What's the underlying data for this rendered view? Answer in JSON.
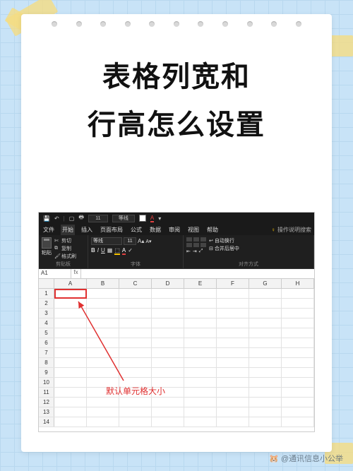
{
  "title_line1": "表格列宽和",
  "title_line2": "行高怎么设置",
  "qat": {
    "size_value": "11",
    "font_value": "等线"
  },
  "ribbon": {
    "tabs": [
      "文件",
      "开始",
      "插入",
      "页面布局",
      "公式",
      "数据",
      "审阅",
      "视图",
      "帮助"
    ],
    "tell_me": "操作说明搜索",
    "clipboard": {
      "paste": "粘贴",
      "cut": "剪切",
      "copy": "复制",
      "format_painter": "格式刷",
      "label": "剪贴板"
    },
    "font": {
      "name": "等线",
      "size": "11",
      "label": "字体"
    },
    "align": {
      "wrap": "自动换行",
      "merge": "合并后居中",
      "label": "对齐方式"
    }
  },
  "namebox": "A1",
  "columns": [
    "A",
    "B",
    "C",
    "D",
    "E",
    "F",
    "G",
    "H"
  ],
  "row_count": 14,
  "annotation": "默认单元格大小",
  "watermark": "@通讯信息小公举"
}
